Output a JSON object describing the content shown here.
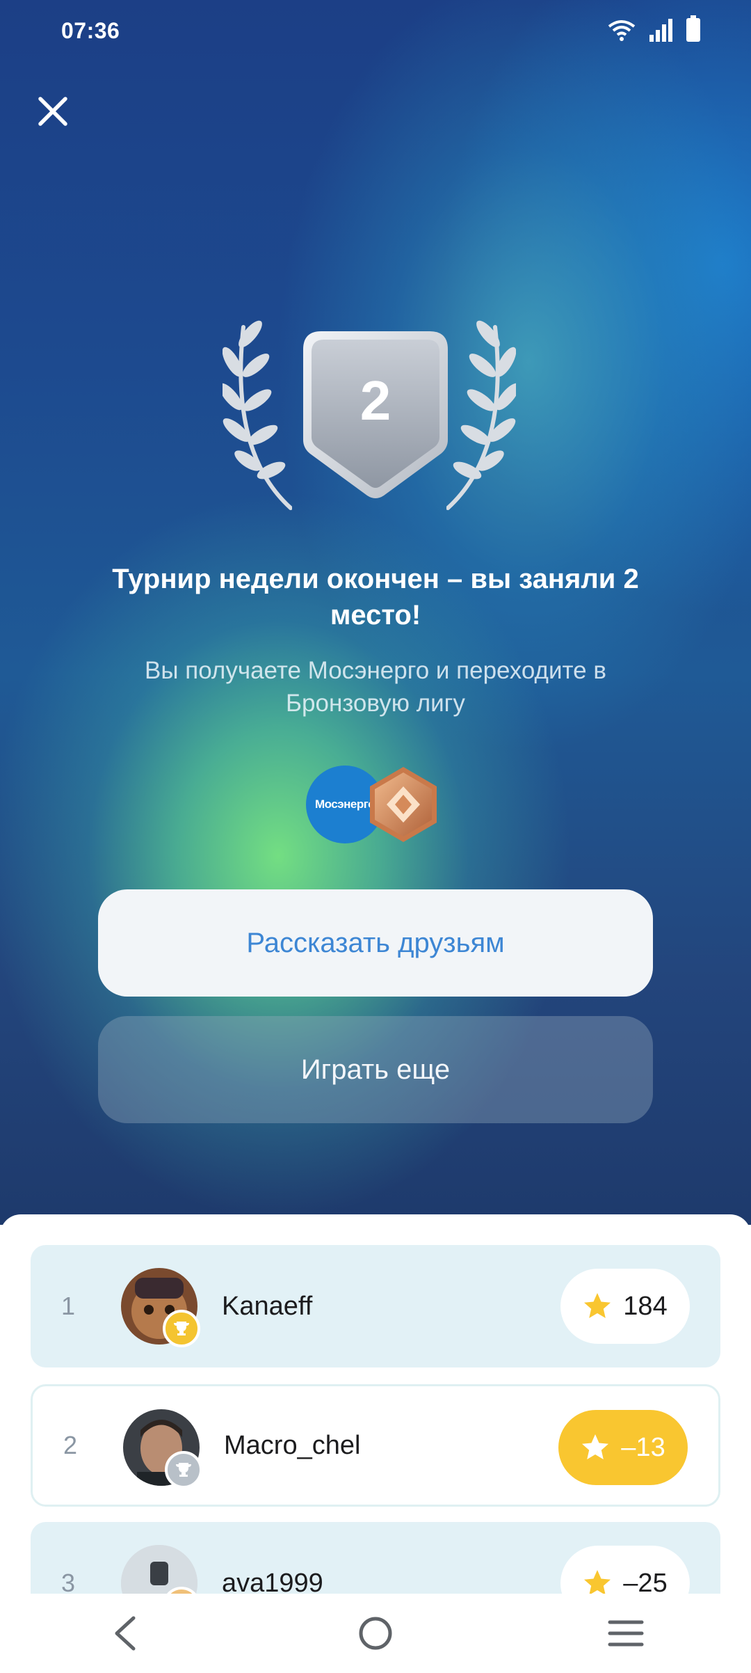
{
  "status_bar": {
    "time": "07:36"
  },
  "result": {
    "place": "2",
    "title": "Турнир недели окончен – вы заняли 2 место!",
    "subtitle": "Вы получаете Мосэнерго и переходите в Бронзовую лигу"
  },
  "rewards": {
    "sponsor_text": "Мосэнерго"
  },
  "buttons": {
    "share": "Рассказать друзьям",
    "play_again": "Играть еще"
  },
  "leaderboard": [
    {
      "rank": "1",
      "name": "Kanaeff",
      "score": "184",
      "cup_color": "#f4c430"
    },
    {
      "rank": "2",
      "name": "Macro_chel",
      "score": "–13",
      "cup_color": "#b8c0c8"
    },
    {
      "rank": "3",
      "name": "ava1999",
      "score": "–25",
      "cup_color": "#f0c078"
    }
  ],
  "colors": {
    "accent": "#3d86d4",
    "star": "#f9c630",
    "row_highlight": "#e2f1f6"
  }
}
